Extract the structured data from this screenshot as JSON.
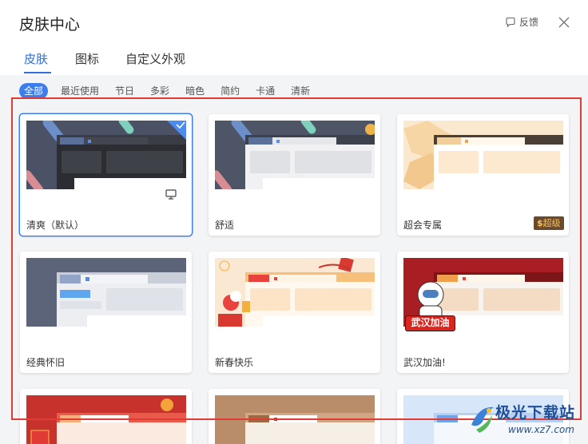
{
  "window": {
    "title": "皮肤中心",
    "feedback_label": "反馈"
  },
  "tabs": [
    {
      "label": "皮肤",
      "active": true
    },
    {
      "label": "图标",
      "active": false
    },
    {
      "label": "自定义外观",
      "active": false
    }
  ],
  "filters": [
    {
      "label": "全部",
      "active": true
    },
    {
      "label": "最近使用"
    },
    {
      "label": "节日"
    },
    {
      "label": "多彩"
    },
    {
      "label": "暗色"
    },
    {
      "label": "简约"
    },
    {
      "label": "卡通"
    },
    {
      "label": "清新"
    }
  ],
  "skins": [
    {
      "name": "清爽（默认）",
      "selected": true,
      "theme": "dark"
    },
    {
      "name": "舒适",
      "theme": "light-gray"
    },
    {
      "name": "超会专属",
      "theme": "peach",
      "badge": "超级"
    },
    {
      "name": "经典怀旧",
      "theme": "classic"
    },
    {
      "name": "新春快乐",
      "theme": "newyear"
    },
    {
      "name": "武汉加油!",
      "theme": "wuhan",
      "banner": "武汉加油"
    }
  ],
  "colors": {
    "accent": "#2f6fe0",
    "highlight_outline": "#e23b35",
    "content_bg": "#f3f4f6"
  },
  "watermark": {
    "title": "极光下载站",
    "url": "www.xz7.com"
  }
}
